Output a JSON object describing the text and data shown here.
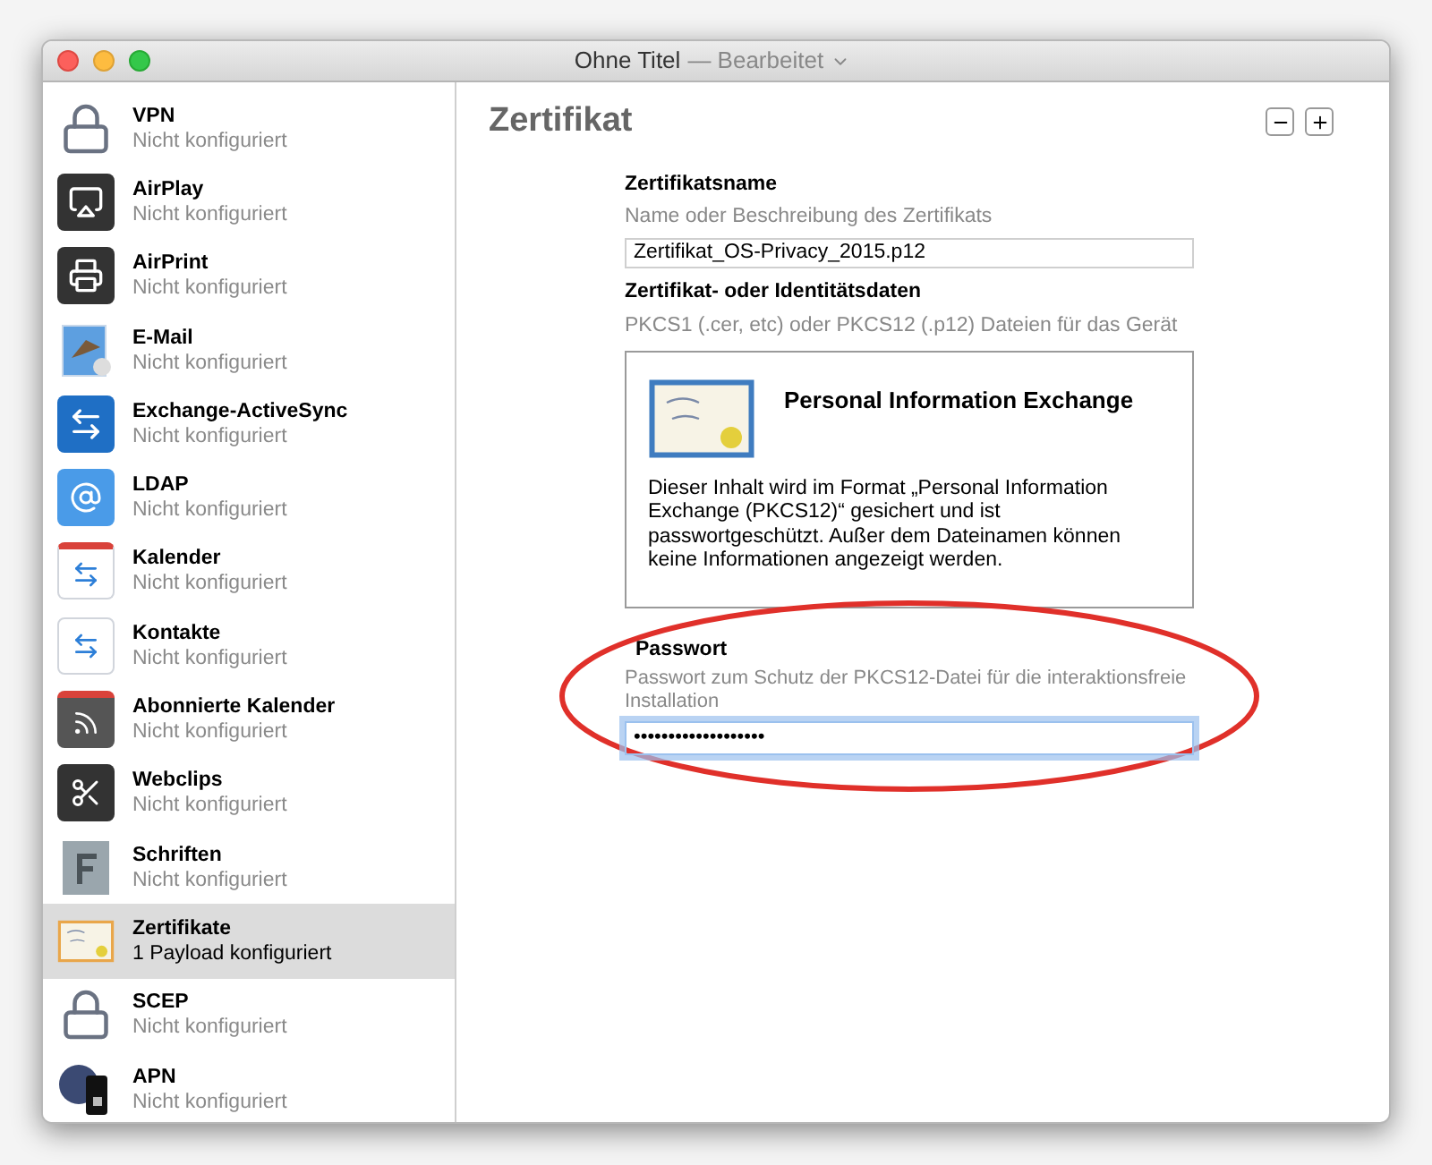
{
  "window": {
    "title": "Ohne Titel",
    "subtitle": "— Bearbeitet"
  },
  "sidebar": {
    "items": [
      {
        "kind": "lock",
        "name": "VPN",
        "status": "Nicht konfiguriert",
        "selected": false
      },
      {
        "kind": "airplay",
        "name": "AirPlay",
        "status": "Nicht konfiguriert",
        "selected": false
      },
      {
        "kind": "printer",
        "name": "AirPrint",
        "status": "Nicht konfiguriert",
        "selected": false
      },
      {
        "kind": "mail",
        "name": "E-Mail",
        "status": "Nicht konfiguriert",
        "selected": false
      },
      {
        "kind": "exchange",
        "name": "Exchange-ActiveSync",
        "status": "Nicht konfiguriert",
        "selected": false
      },
      {
        "kind": "at",
        "name": "LDAP",
        "status": "Nicht konfiguriert",
        "selected": false
      },
      {
        "kind": "calendar",
        "name": "Kalender",
        "status": "Nicht konfiguriert",
        "selected": false
      },
      {
        "kind": "contacts",
        "name": "Kontakte",
        "status": "Nicht konfiguriert",
        "selected": false
      },
      {
        "kind": "rss",
        "name": "Abonnierte Kalender",
        "status": "Nicht konfiguriert",
        "selected": false
      },
      {
        "kind": "scissors",
        "name": "Webclips",
        "status": "Nicht konfiguriert",
        "selected": false
      },
      {
        "kind": "font",
        "name": "Schriften",
        "status": "Nicht konfiguriert",
        "selected": false
      },
      {
        "kind": "certificate",
        "name": "Zertifikate",
        "status": "1 Payload konfiguriert",
        "selected": true
      },
      {
        "kind": "lock-code",
        "name": "SCEP",
        "status": "Nicht konfiguriert",
        "selected": false
      },
      {
        "kind": "globe-phone",
        "name": "APN",
        "status": "Nicht konfiguriert",
        "selected": false
      }
    ]
  },
  "main": {
    "title": "Zertifikat",
    "certificate_name": {
      "label": "Zertifikatsname",
      "hint": "Name oder Beschreibung des Zertifikats",
      "value": "Zertifikat_OS-Privacy_2015.p12"
    },
    "certificate_data": {
      "label": "Zertifikat- oder Identitätsdaten",
      "hint": "PKCS1 (.cer, etc) oder PKCS12 (.p12) Dateien für das Gerät",
      "card_title": "Personal Information Exchange",
      "card_text": "Dieser Inhalt wird im Format „Personal Information Exchange (PKCS12)“ gesichert und ist passwortgeschützt. Außer dem Dateinamen können keine Informationen angezeigt werden."
    },
    "password": {
      "label": "Passwort",
      "hint": "Passwort zum Schutz der PKCS12-Datei für die interaktionsfreie Installation",
      "value": "•••••••••••••••••••",
      "focused": true
    }
  }
}
